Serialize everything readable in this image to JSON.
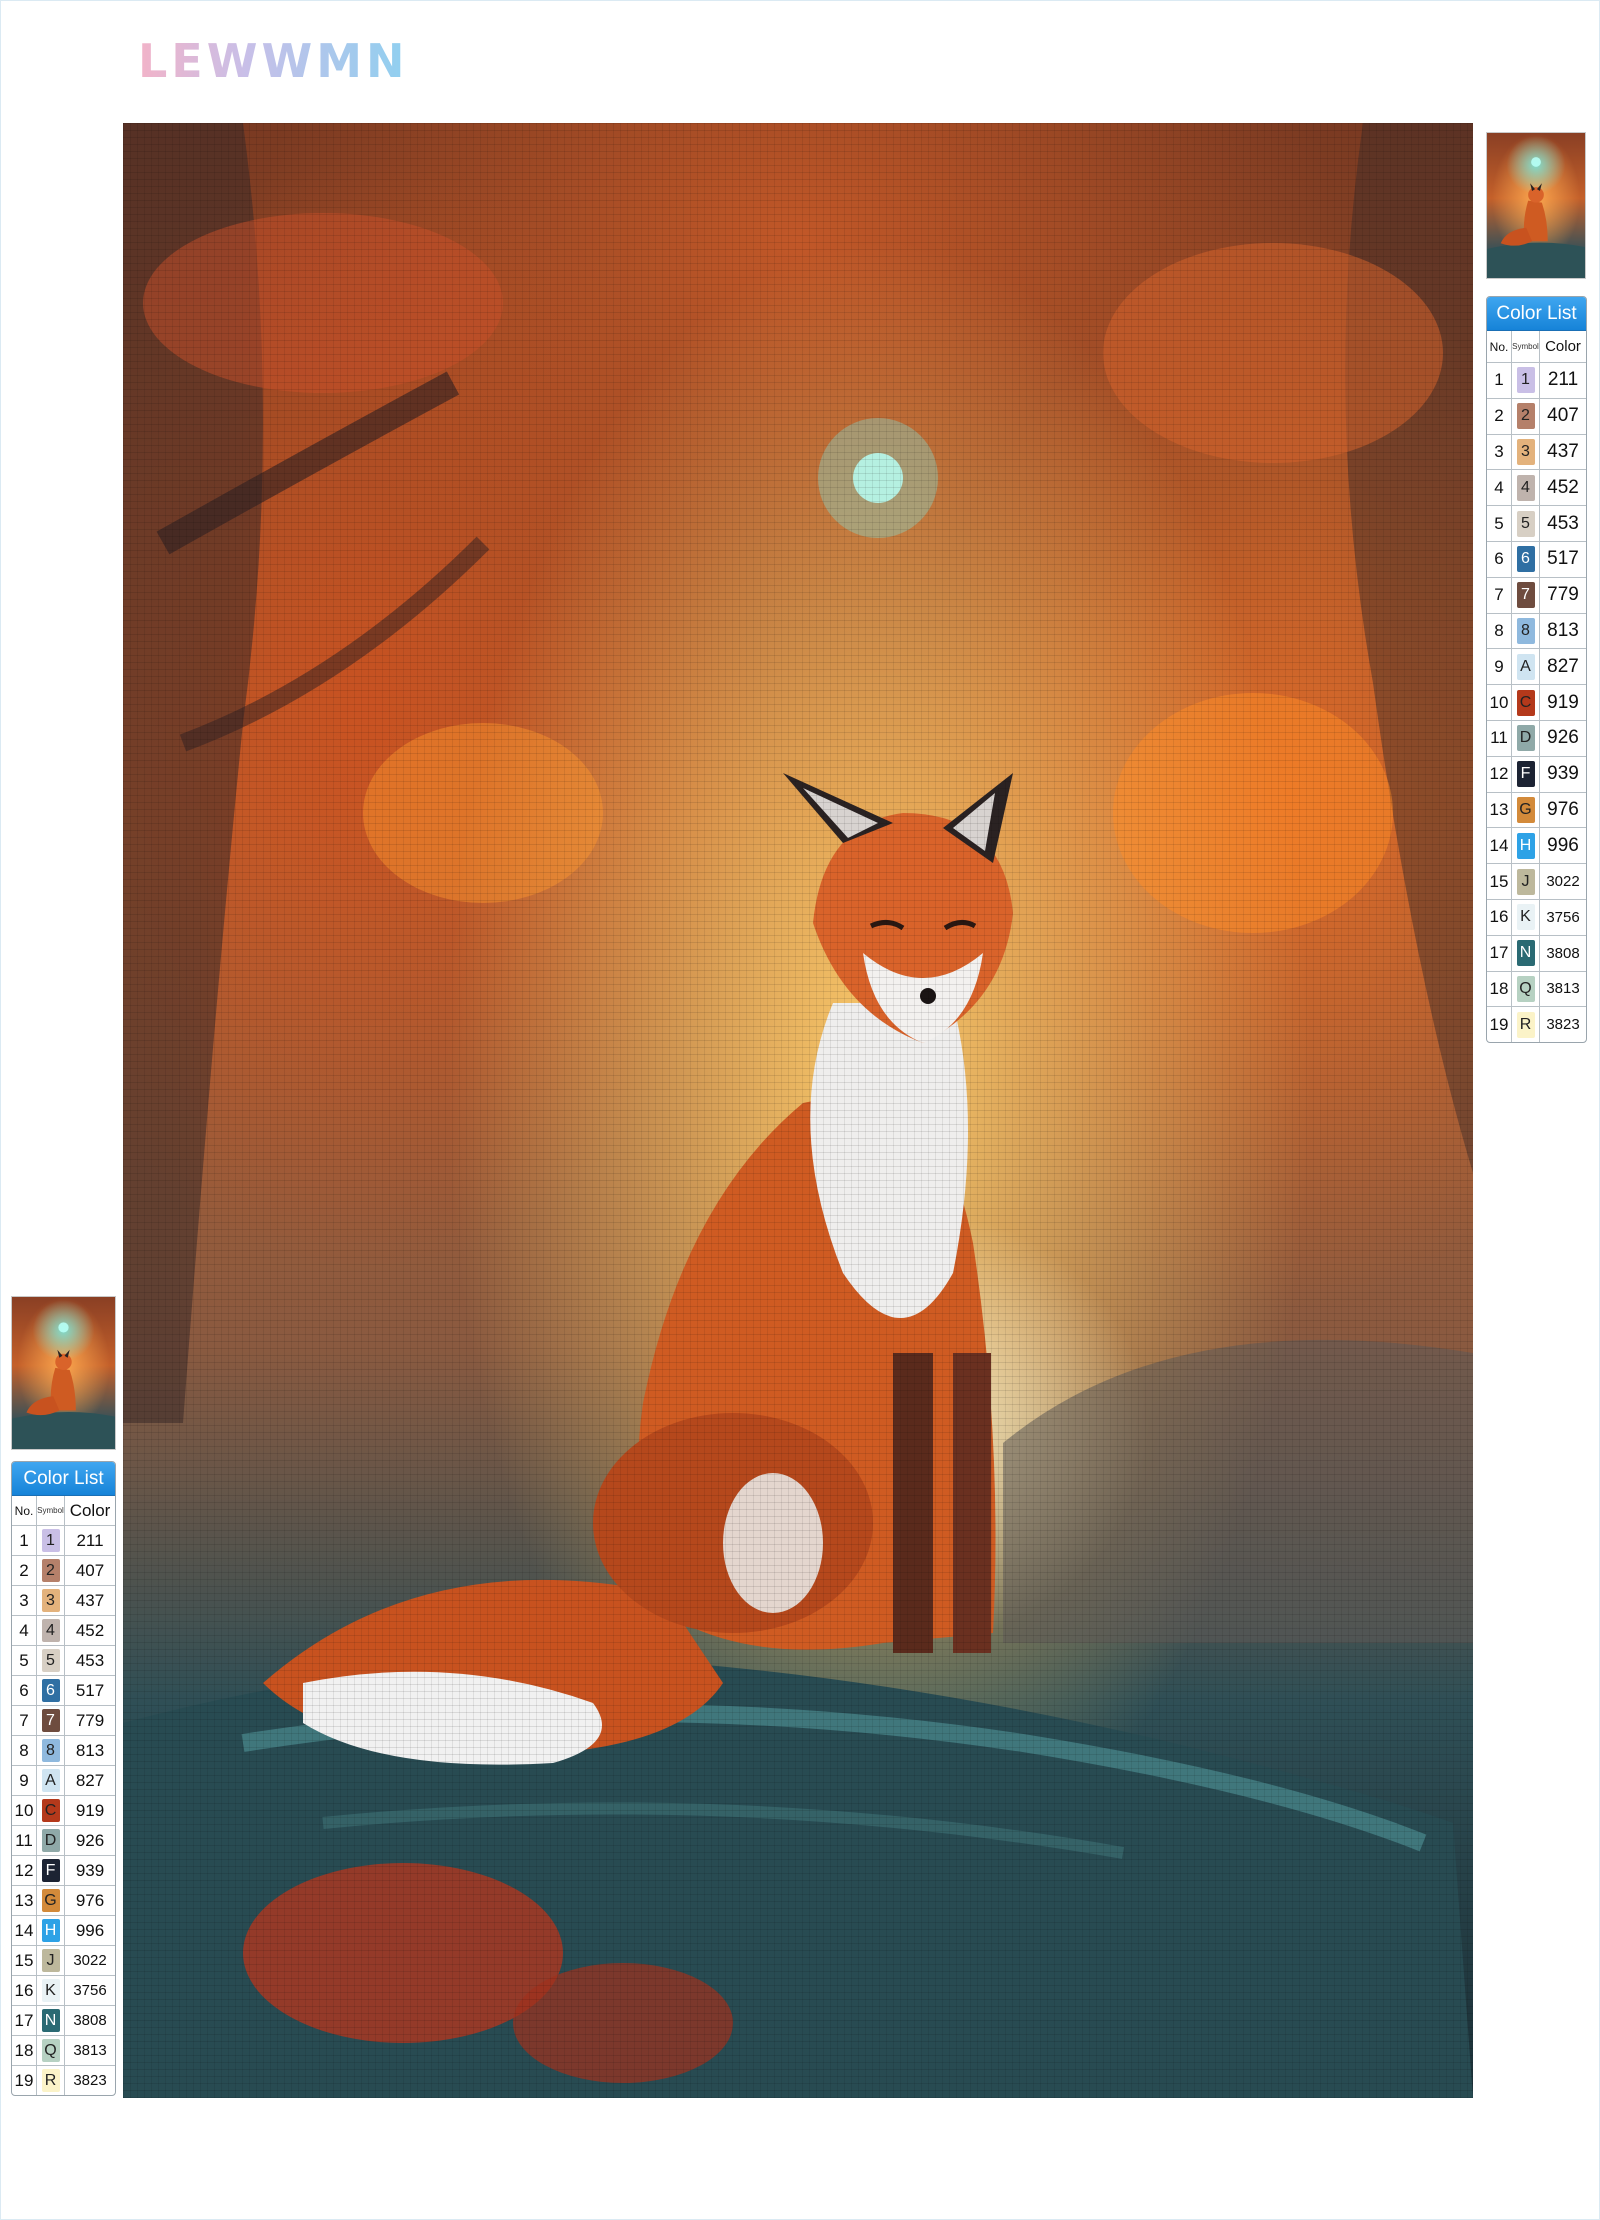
{
  "brand": {
    "logo_text": "LEWWMN"
  },
  "artwork": {
    "subject": "fox-painting"
  },
  "color_list": {
    "title": "Color List",
    "headers": {
      "no": "No.",
      "symbol": "Symbol",
      "color": "Color"
    },
    "rows": [
      {
        "no": "1",
        "symbol": "1",
        "color": "211",
        "swatch": "#c9bfe6",
        "text": "#222"
      },
      {
        "no": "2",
        "symbol": "2",
        "color": "407",
        "swatch": "#b5806a",
        "text": "#222"
      },
      {
        "no": "3",
        "symbol": "3",
        "color": "437",
        "swatch": "#e3b27c",
        "text": "#222"
      },
      {
        "no": "4",
        "symbol": "4",
        "color": "452",
        "swatch": "#bfb3ad",
        "text": "#222"
      },
      {
        "no": "5",
        "symbol": "5",
        "color": "453",
        "swatch": "#d7cfc4",
        "text": "#222"
      },
      {
        "no": "6",
        "symbol": "6",
        "color": "517",
        "swatch": "#2f6fa3",
        "text": "#fff"
      },
      {
        "no": "7",
        "symbol": "7",
        "color": "779",
        "swatch": "#6e4c3f",
        "text": "#fff"
      },
      {
        "no": "8",
        "symbol": "8",
        "color": "813",
        "swatch": "#8fb9de",
        "text": "#222"
      },
      {
        "no": "9",
        "symbol": "A",
        "color": "827",
        "swatch": "#cfe4f1",
        "text": "#222"
      },
      {
        "no": "10",
        "symbol": "C",
        "color": "919",
        "swatch": "#b4391b",
        "text": "#222"
      },
      {
        "no": "11",
        "symbol": "D",
        "color": "926",
        "swatch": "#8fa9a8",
        "text": "#222"
      },
      {
        "no": "12",
        "symbol": "F",
        "color": "939",
        "swatch": "#1c2333",
        "text": "#fff"
      },
      {
        "no": "13",
        "symbol": "G",
        "color": "976",
        "swatch": "#d38a3a",
        "text": "#222"
      },
      {
        "no": "14",
        "symbol": "H",
        "color": "996",
        "swatch": "#2ea2e6",
        "text": "#fff"
      },
      {
        "no": "15",
        "symbol": "J",
        "color": "3022",
        "swatch": "#bdb89c",
        "text": "#222"
      },
      {
        "no": "16",
        "symbol": "K",
        "color": "3756",
        "swatch": "#e9f2f5",
        "text": "#222"
      },
      {
        "no": "17",
        "symbol": "N",
        "color": "3808",
        "swatch": "#2a6a73",
        "text": "#fff"
      },
      {
        "no": "18",
        "symbol": "Q",
        "color": "3813",
        "swatch": "#b6d1c2",
        "text": "#222"
      },
      {
        "no": "19",
        "symbol": "R",
        "color": "3823",
        "swatch": "#fbf3c8",
        "text": "#222"
      }
    ]
  },
  "colors": {
    "title_bar": "#1683d8",
    "border": "#9aa5ad"
  }
}
